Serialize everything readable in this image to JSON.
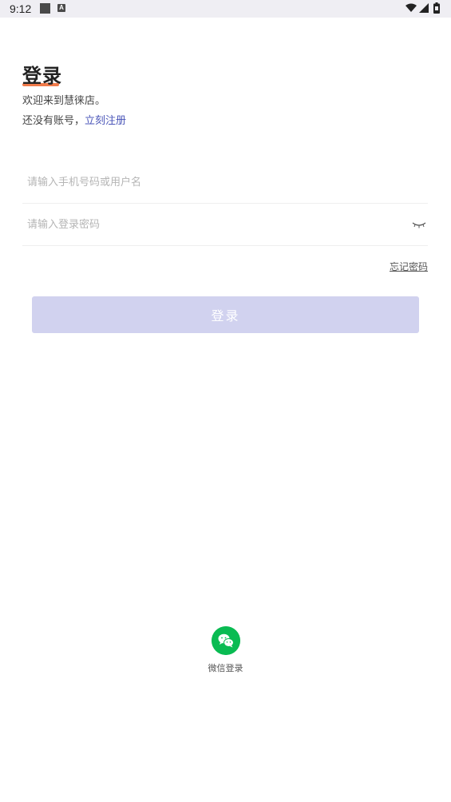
{
  "status_bar": {
    "time": "9:12",
    "indicator_letter": "A"
  },
  "header": {
    "title": "登录",
    "welcome": "欢迎来到慧徕店。",
    "no_account_prefix": "还没有账号，",
    "register_link": "立刻注册"
  },
  "form": {
    "username_placeholder": "请输入手机号码或用户名",
    "password_placeholder": "请输入登录密码",
    "forgot_password": "忘记密码",
    "login_button": "登录"
  },
  "social": {
    "wechat_label": "微信登录"
  },
  "colors": {
    "accent": "#4a55b8",
    "title_underline": "#f07a4a",
    "login_button_bg": "#d1d2ef",
    "wechat_green": "#09bb52"
  }
}
